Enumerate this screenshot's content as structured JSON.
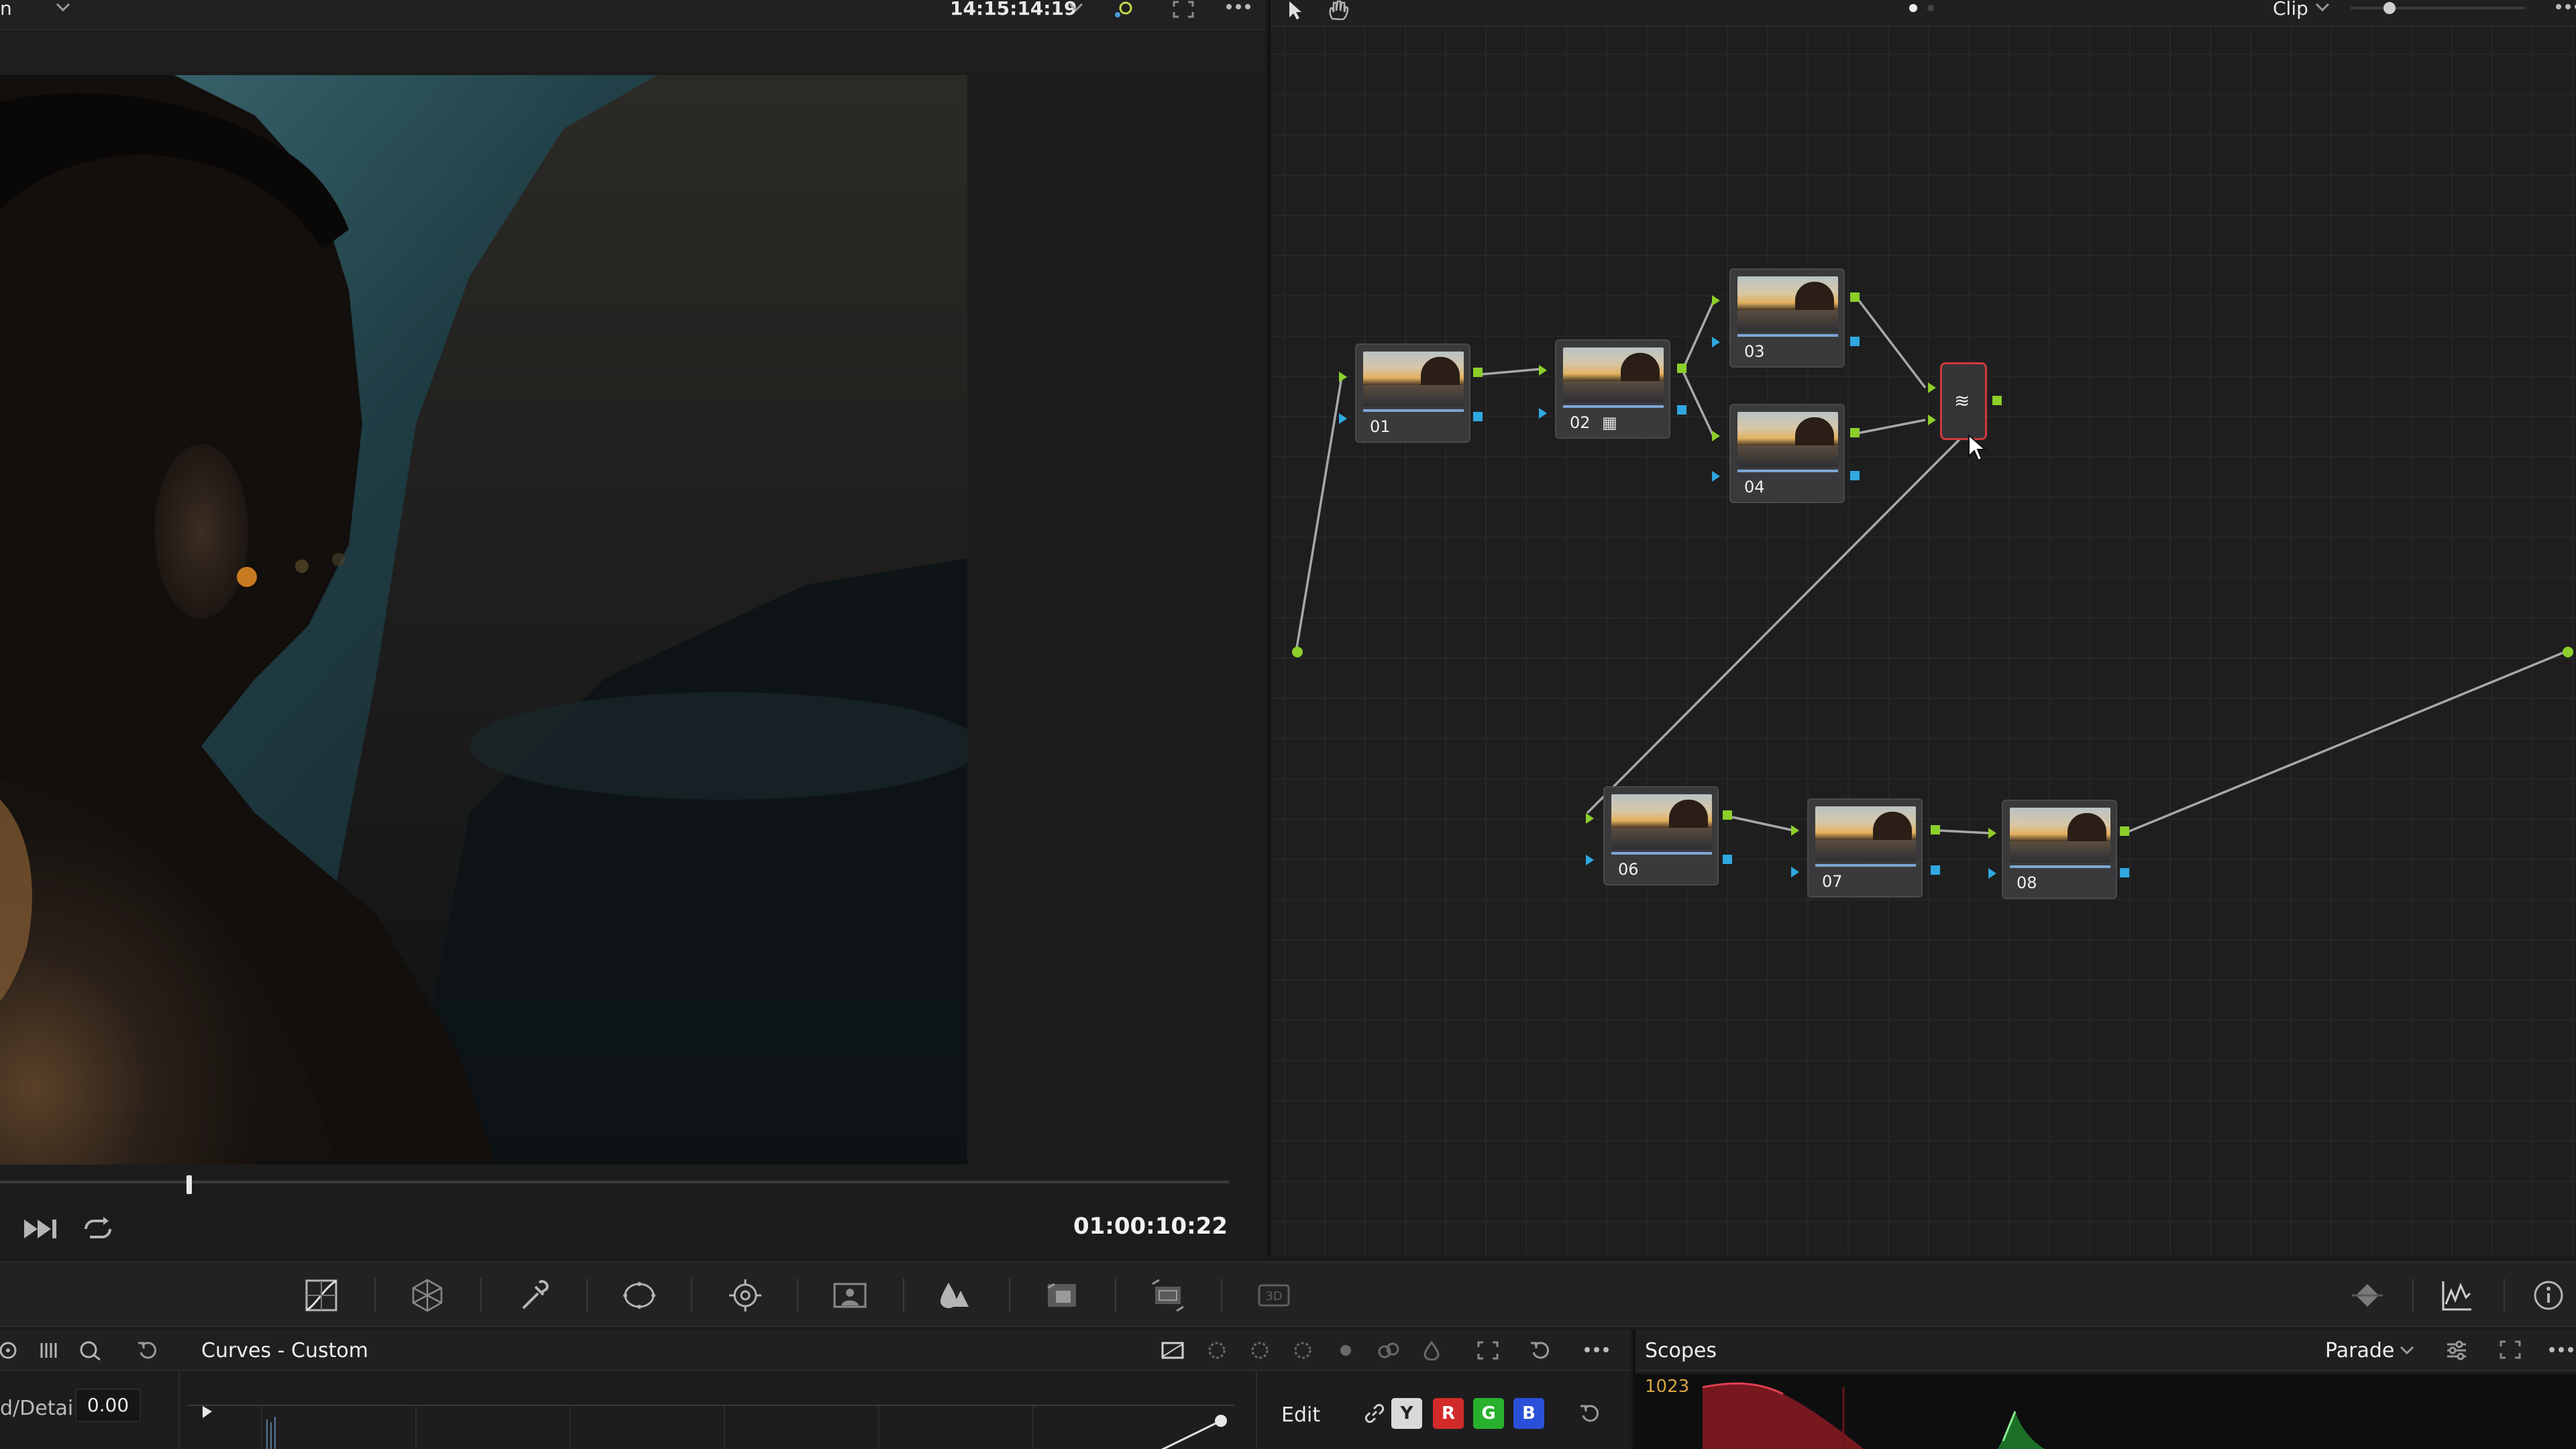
{
  "viewer": {
    "topbar_left_fragment": "n",
    "source_timecode": "14:15:14:19",
    "record_timecode": "01:00:10:22"
  },
  "node_editor": {
    "mode_label": "Clip",
    "nodes": [
      {
        "id": "01",
        "label": "01"
      },
      {
        "id": "02",
        "label": "02"
      },
      {
        "id": "03",
        "label": "03"
      },
      {
        "id": "04",
        "label": "04"
      },
      {
        "id": "06",
        "label": "06"
      },
      {
        "id": "07",
        "label": "07"
      },
      {
        "id": "08",
        "label": "08"
      }
    ]
  },
  "curves_panel": {
    "title": "Curves - Custom",
    "detail_label": "d/Detail",
    "detail_value": "0.00",
    "edit_label": "Edit",
    "channels": [
      {
        "key": "Y",
        "label": "Y",
        "color": "#d9d9d9"
      },
      {
        "key": "R",
        "label": "R",
        "color": "#d12a2a"
      },
      {
        "key": "G",
        "label": "G",
        "color": "#27b12d"
      },
      {
        "key": "B",
        "label": "B",
        "color": "#2b50d8"
      }
    ]
  },
  "scopes_panel": {
    "title": "Scopes",
    "mode": "Parade",
    "max_value": "1023"
  },
  "palette_icons": [
    "curves-icon",
    "color-warper-icon",
    "qualifier-icon",
    "window-icon",
    "tracker-icon",
    "magic-mask-icon",
    "blur-icon",
    "key-icon",
    "sizing-icon",
    "3d-icon",
    "keyframes-icon",
    "scopes-icon",
    "info-icon"
  ]
}
